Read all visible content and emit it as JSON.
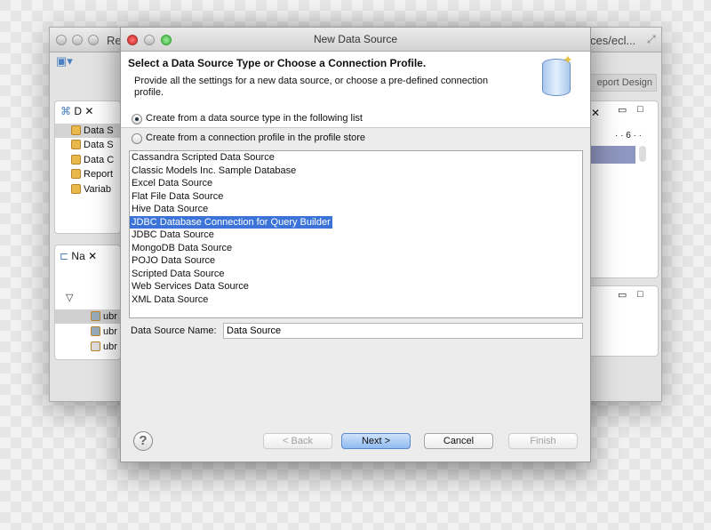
{
  "background_window": {
    "title_left": "Re",
    "title_right": "ces/ecl...",
    "report_design": "eport Design",
    "ruler_mark": "6",
    "data_explorer_tab": "D",
    "navigator_tab": "Na",
    "tree_items": [
      "Data S",
      "Data S",
      "Data C",
      "Report",
      "Variab"
    ],
    "nav_items": [
      "ubr",
      "ubr",
      "ubr"
    ]
  },
  "dialog": {
    "title": "New Data Source",
    "heading": "Select a Data Source Type or Choose a Connection Profile.",
    "description": "Provide all the settings for a new data source, or choose a pre-defined connection profile.",
    "radio_type": "Create from a data source type in the following list",
    "radio_profile": "Create from a connection profile in the profile store",
    "selected_radio": "type",
    "types": [
      "Cassandra Scripted Data Source",
      "Classic Models Inc. Sample Database",
      "Excel Data Source",
      "Flat File Data Source",
      "Hive Data Source",
      "JDBC Database Connection for Query Builder",
      "JDBC Data Source",
      "MongoDB Data Source",
      "POJO Data Source",
      "Scripted Data Source",
      "Web Services Data Source",
      "XML Data Source"
    ],
    "selected_type": "JDBC Database Connection for Query Builder",
    "name_label": "Data Source Name:",
    "name_value": "Data Source",
    "buttons": {
      "back": "< Back",
      "next": "Next >",
      "cancel": "Cancel",
      "finish": "Finish"
    },
    "selection_color": "#3b73d8"
  }
}
